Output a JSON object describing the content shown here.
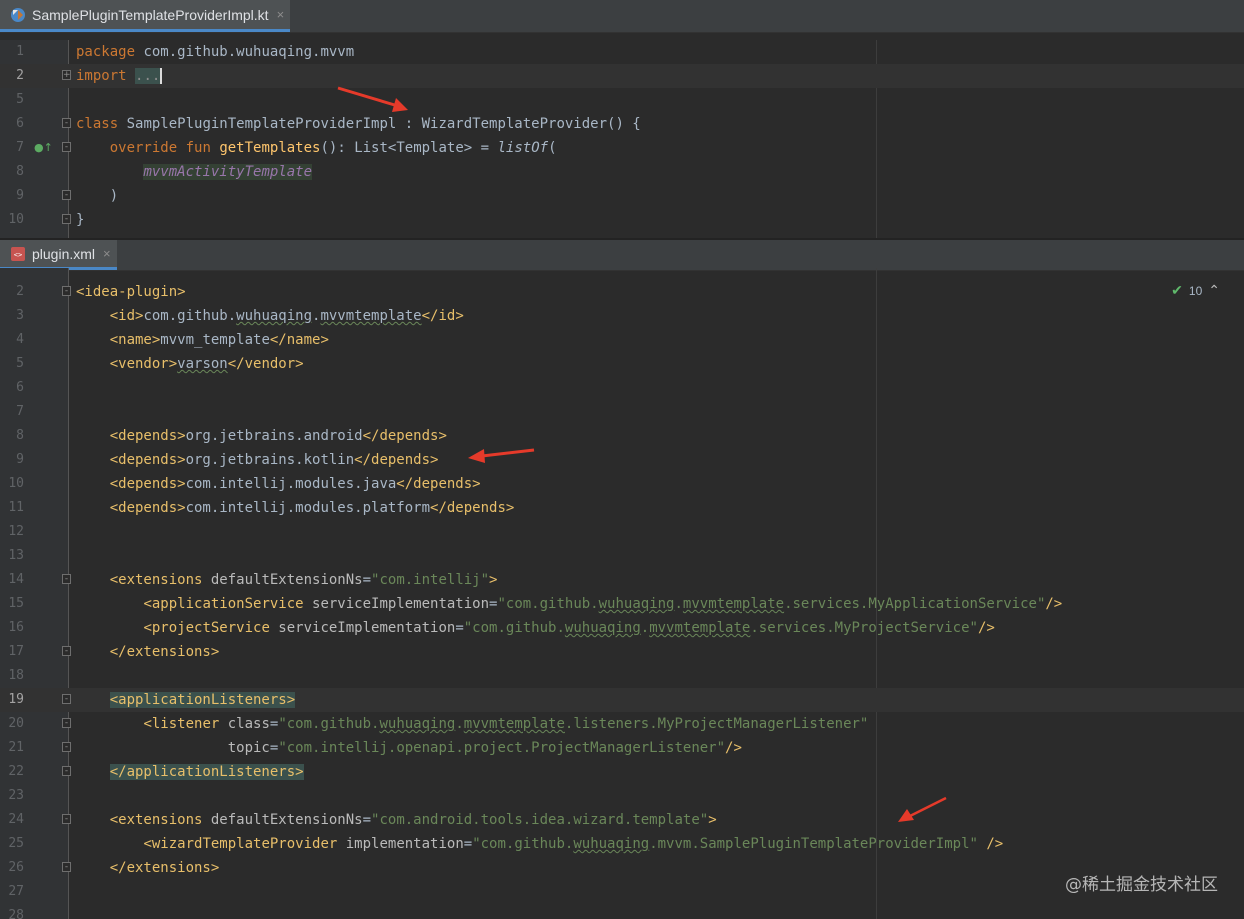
{
  "kt_pane": {
    "tab_label": "SamplePluginTemplateProviderImpl.kt",
    "tab_close": "×",
    "lines": [
      {
        "n": "1"
      },
      {
        "n": "2"
      },
      {
        "n": "5"
      },
      {
        "n": "6"
      },
      {
        "n": "7"
      },
      {
        "n": "8"
      },
      {
        "n": "9"
      },
      {
        "n": "10"
      }
    ],
    "code": {
      "l1_kw": "package",
      "l1_rest": " com.github.wuhuaqing.mvvm",
      "l2_kw": "import",
      "l2_rest": "...",
      "l6_kw": "class",
      "l6_rest": " SamplePluginTemplateProviderImpl : WizardTemplateProvider() {",
      "l7_kw1": "override",
      "l7_kw2": "fun",
      "l7_fn": "getTemplates",
      "l7_mid": "(): List<Template> = ",
      "l7_call": "listOf",
      "l7_end": "(",
      "l8_prop": "mvvmActivityTemplate",
      "l9": ")",
      "l10": "}"
    }
  },
  "xml_pane": {
    "tab_label": "plugin.xml",
    "tab_close": "×",
    "inspection_count": "10",
    "lines": [
      "2",
      "3",
      "4",
      "5",
      "6",
      "7",
      "8",
      "9",
      "10",
      "11",
      "12",
      "13",
      "14",
      "15",
      "16",
      "17",
      "18",
      "19",
      "20",
      "21",
      "22",
      "23",
      "24",
      "25",
      "26",
      "27",
      "28"
    ],
    "code": {
      "l2_tag": "<idea-plugin>",
      "l3_open": "<id>",
      "l3_a": "com.github.",
      "l3_b": "wuhuaqing",
      "l3_c": ".",
      "l3_d": "mvvmtemplate",
      "l3_close": "</id>",
      "l4_open": "<name>",
      "l4_text": "mvvm_template",
      "l4_close": "</name>",
      "l5_open": "<vendor>",
      "l5_text": "varson",
      "l5_close": "</vendor>",
      "l8_open": "<depends>",
      "l8_text": "org.jetbrains.android",
      "l8_close": "</depends>",
      "l9_open": "<depends>",
      "l9_text": "org.jetbrains.kotlin",
      "l9_close": "</depends>",
      "l10_open": "<depends>",
      "l10_text": "com.intellij.modules.java",
      "l10_close": "</depends>",
      "l11_open": "<depends>",
      "l11_text": "com.intellij.modules.platform",
      "l11_close": "</depends>",
      "l14_tag": "<extensions",
      "l14_attr": " defaultExtensionNs",
      "l14_eq": "=",
      "l14_val": "\"com.intellij\"",
      "l14_end": ">",
      "l15_tag": "<applicationService",
      "l15_attr": " serviceImplementation",
      "l15_eq": "=",
      "l15_v1": "\"com.github.",
      "l15_v2": "wuhuaqing",
      "l15_v3": ".",
      "l15_v4": "mvvmtemplate",
      "l15_v5": ".services.MyApplicationService\"",
      "l15_end": "/>",
      "l16_tag": "<projectService",
      "l16_attr": " serviceImplementation",
      "l16_eq": "=",
      "l16_v1": "\"com.github.",
      "l16_v2": "wuhuaqing",
      "l16_v3": ".",
      "l16_v4": "mvvmtemplate",
      "l16_v5": ".services.MyProjectService\"",
      "l16_end": "/>",
      "l17_tag": "</extensions>",
      "l19_tag": "<applicationListeners>",
      "l20_tag": "<listener",
      "l20_attr": " class",
      "l20_eq": "=",
      "l20_v1": "\"com.github.",
      "l20_v2": "wuhuaqing",
      "l20_v3": ".",
      "l20_v4": "mvvmtemplate",
      "l20_v5": ".listeners.MyProjectManagerListener\"",
      "l21_attr": "topic",
      "l21_eq": "=",
      "l21_val": "\"com.intellij.openapi.project.ProjectManagerListener\"",
      "l21_end": "/>",
      "l22_tag": "</applicationListeners>",
      "l24_tag": "<extensions",
      "l24_attr": " defaultExtensionNs",
      "l24_eq": "=",
      "l24_val": "\"com.android.tools.idea.wizard.template\"",
      "l24_end": ">",
      "l25_tag": "<wizardTemplateProvider",
      "l25_attr": " implementation",
      "l25_eq": "=",
      "l25_v1": "\"com.github.",
      "l25_v2": "wuhuaqing",
      "l25_v3": ".mvvm.SamplePluginTemplateProviderImpl\"",
      "l25_end": " />",
      "l26_tag": "</extensions>"
    }
  },
  "watermark": "@稀土掘金技术社区",
  "colors": {
    "keyword": "#cc7832",
    "tag": "#e8bf6a",
    "string": "#6a8759",
    "function": "#ffc66d",
    "arrow": "#e53a2a",
    "background": "#2b2b2b"
  }
}
